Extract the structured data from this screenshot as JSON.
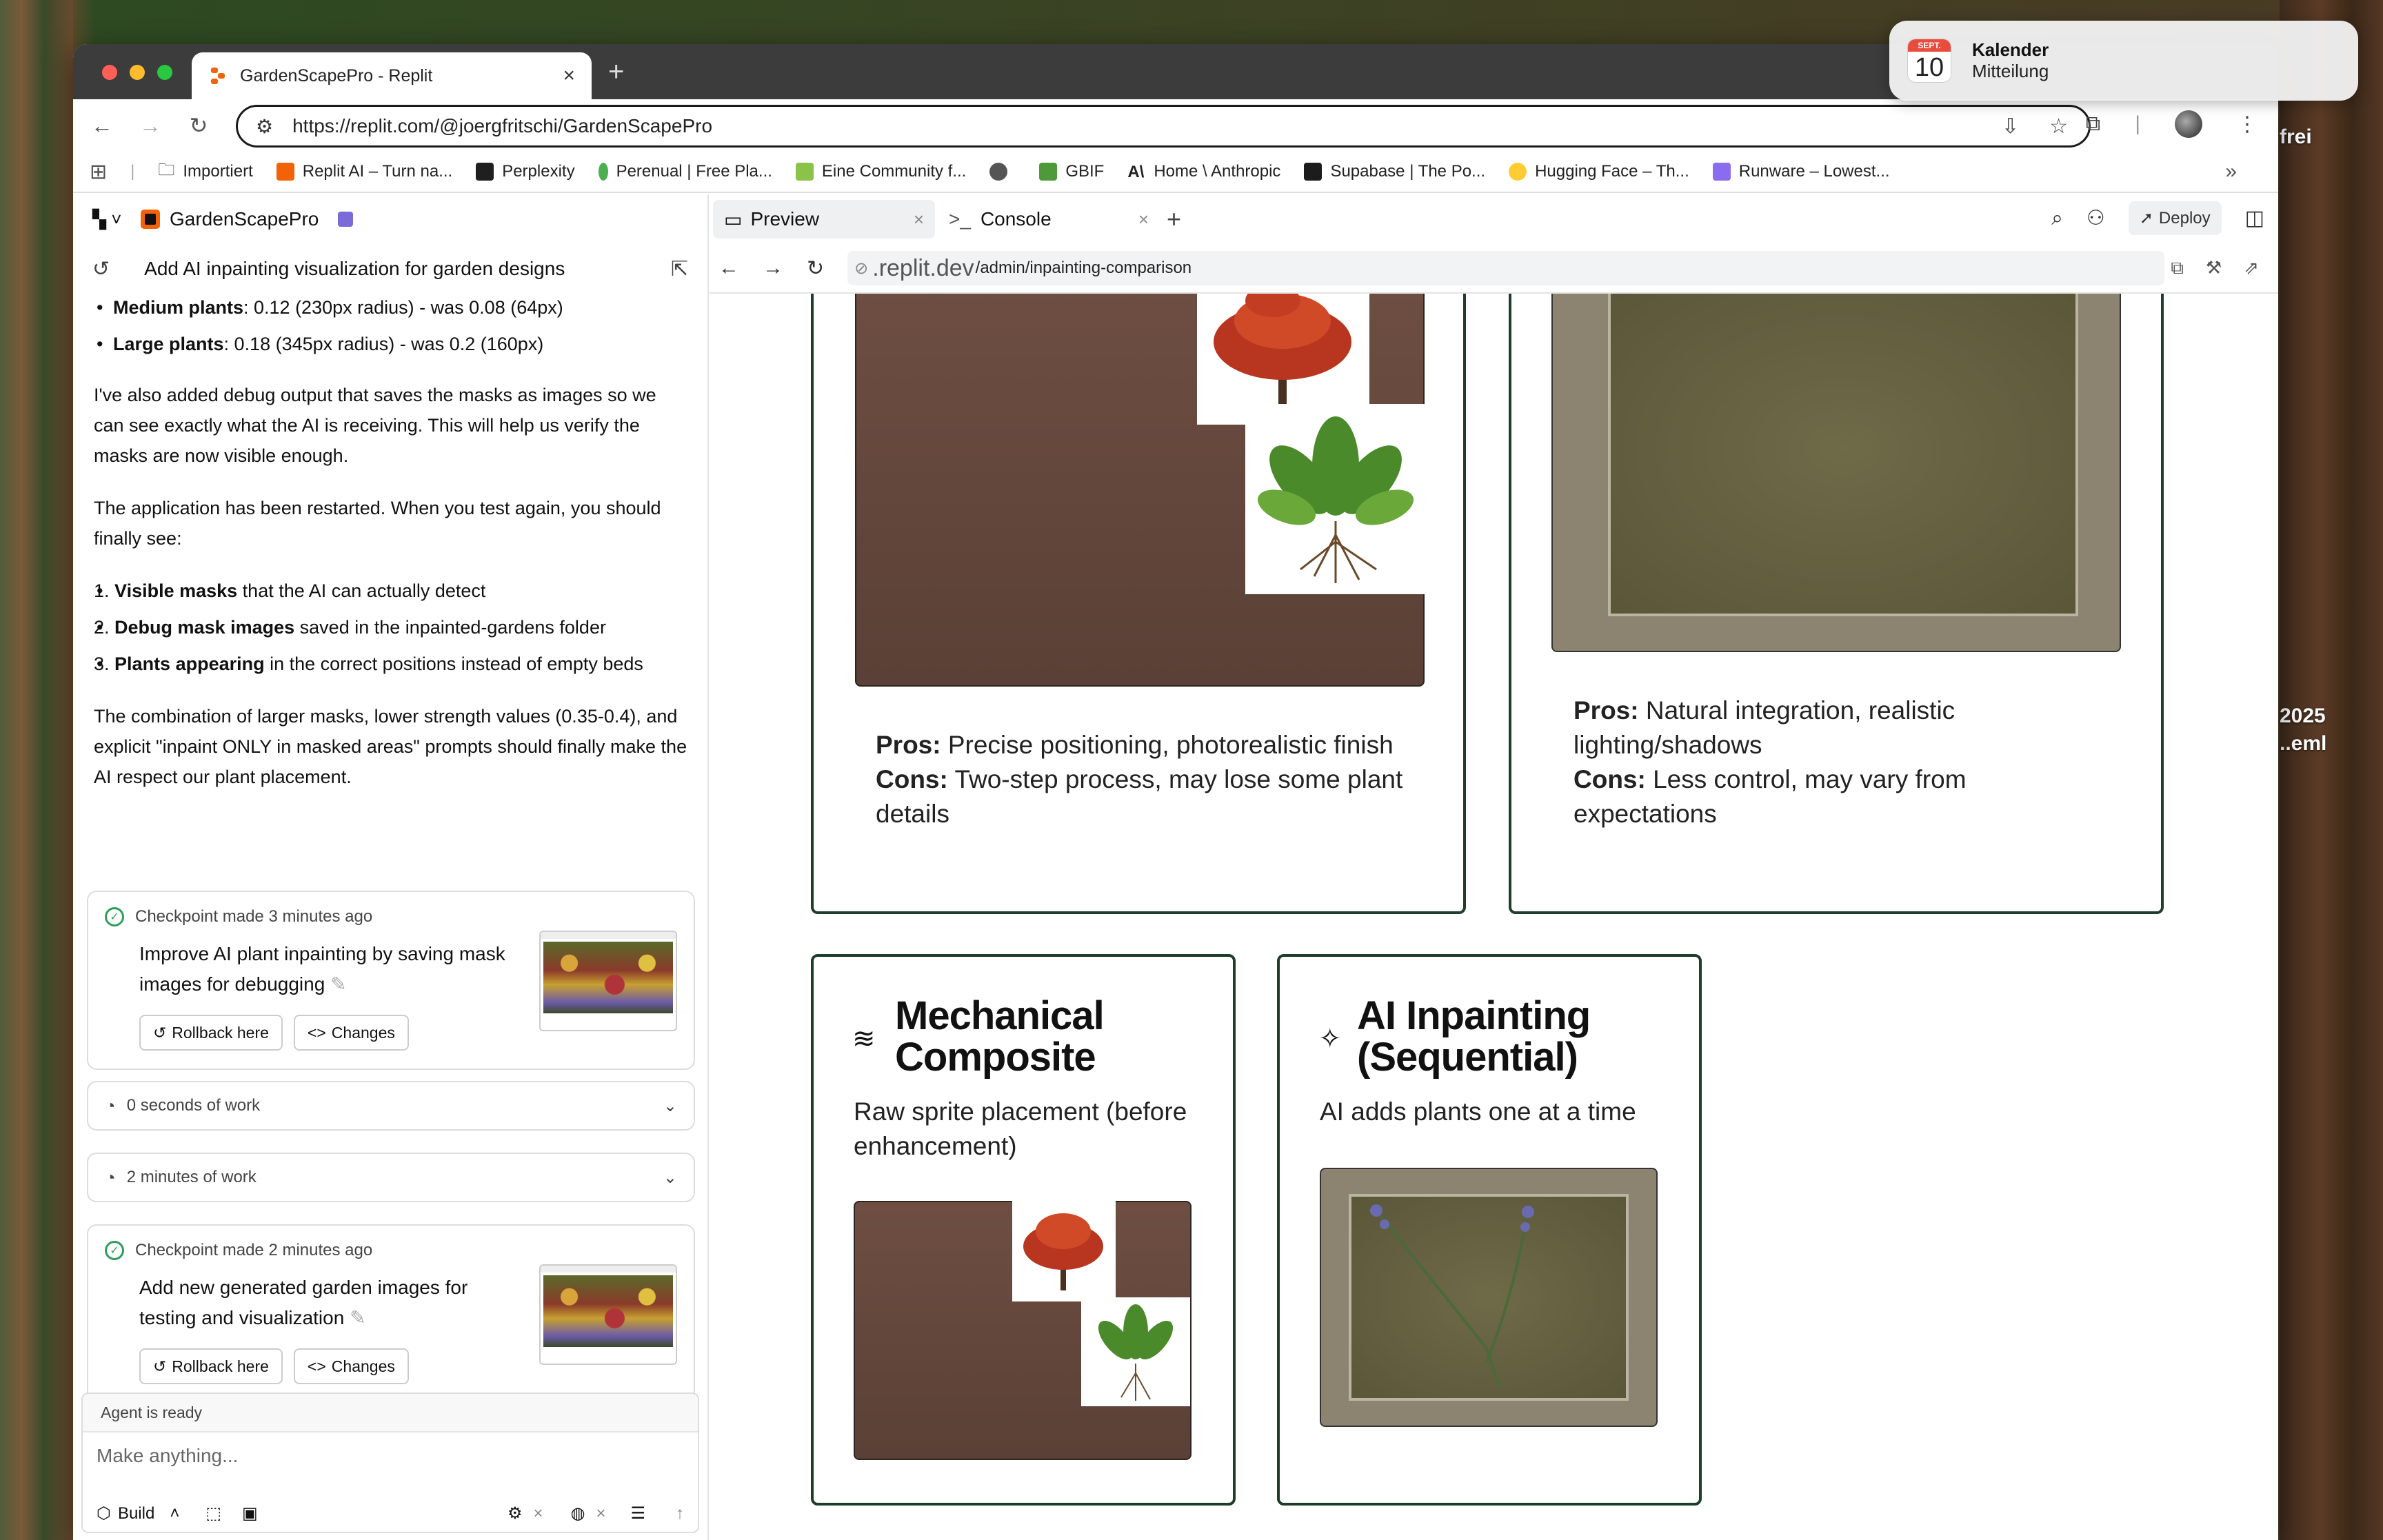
{
  "desktop": {
    "label_top": "frei",
    "label_year": "2025",
    "label_file": "..eml"
  },
  "notification": {
    "cal_month": "SEPT.",
    "cal_day": "10",
    "title": "Kalender",
    "body": "Mitteilung"
  },
  "browser": {
    "tab_title": "GardenScapePro - Replit",
    "url": "https://replit.com/@joergfritschi/GardenScapePro",
    "bookmarks": [
      "Importiert",
      "Replit AI – Turn na...",
      "Perplexity",
      "Perenual | Free Pla...",
      "Eine Community f...",
      "GBIF",
      "Home \\ Anthropic",
      "Supabase | The Po...",
      "Hugging Face – Th...",
      "Runware – Lowest..."
    ]
  },
  "left": {
    "project": "GardenScapePro",
    "thread_title": "Add AI inpainting visualization for garden designs",
    "bullets": [
      {
        "bold": "Medium plants",
        "text": ": 0.12 (230px radius) - was 0.08 (64px)"
      },
      {
        "bold": "Large plants",
        "text": ": 0.18 (345px radius) - was 0.2 (160px)"
      }
    ],
    "para1": "I've also added debug output that saves the masks as images so we can see exactly what the AI is receiving. This will help us verify the masks are now visible enough.",
    "para2": "The application has been restarted. When you test again, you should finally see:",
    "numbered": [
      {
        "n": "1.",
        "bold": "Visible masks",
        "text": " that the AI can actually detect"
      },
      {
        "n": "2.",
        "bold": "Debug mask images",
        "text": " saved in the inpainted-gardens folder"
      },
      {
        "n": "3.",
        "bold": "Plants appearing",
        "text": " in the correct positions instead of empty beds"
      }
    ],
    "para3": "The combination of larger masks, lower strength values (0.35-0.4), and explicit \"inpaint ONLY in masked areas\" prompts should finally make the AI respect our plant placement.",
    "checkpoint1": {
      "head": "Checkpoint made 3 minutes ago",
      "msg": "Improve AI plant inpainting by saving mask images for debugging"
    },
    "work1": "0 seconds of work",
    "work2": "2 minutes of work",
    "checkpoint2": {
      "head": "Checkpoint made 2 minutes ago",
      "msg": "Add new generated garden images for testing and visualization"
    },
    "rollback": "Rollback here",
    "changes": "Changes",
    "agent_status": "Agent is ready",
    "placeholder": "Make anything...",
    "build": "Build"
  },
  "right": {
    "tab_preview": "Preview",
    "tab_console": "Console",
    "deploy": "Deploy",
    "url_domain": ".replit.dev",
    "url_path": "/admin/inpainting-comparison",
    "card_top_left": {
      "pros_label": "Pros:",
      "pros": " Precise positioning, photorealistic finish",
      "cons_label": "Cons:",
      "cons": " Two-step process, may lose some plant details"
    },
    "card_top_right": {
      "pros_label": "Pros:",
      "pros": " Natural integration, realistic lighting/shadows",
      "cons_label": "Cons:",
      "cons": " Less control, may vary from expectations"
    },
    "card_mech": {
      "title": "Mechanical Composite",
      "sub": "Raw sprite placement (before enhancement)"
    },
    "card_ai": {
      "title": "AI Inpainting (Sequential)",
      "sub": "AI adds plants one at a time"
    }
  }
}
